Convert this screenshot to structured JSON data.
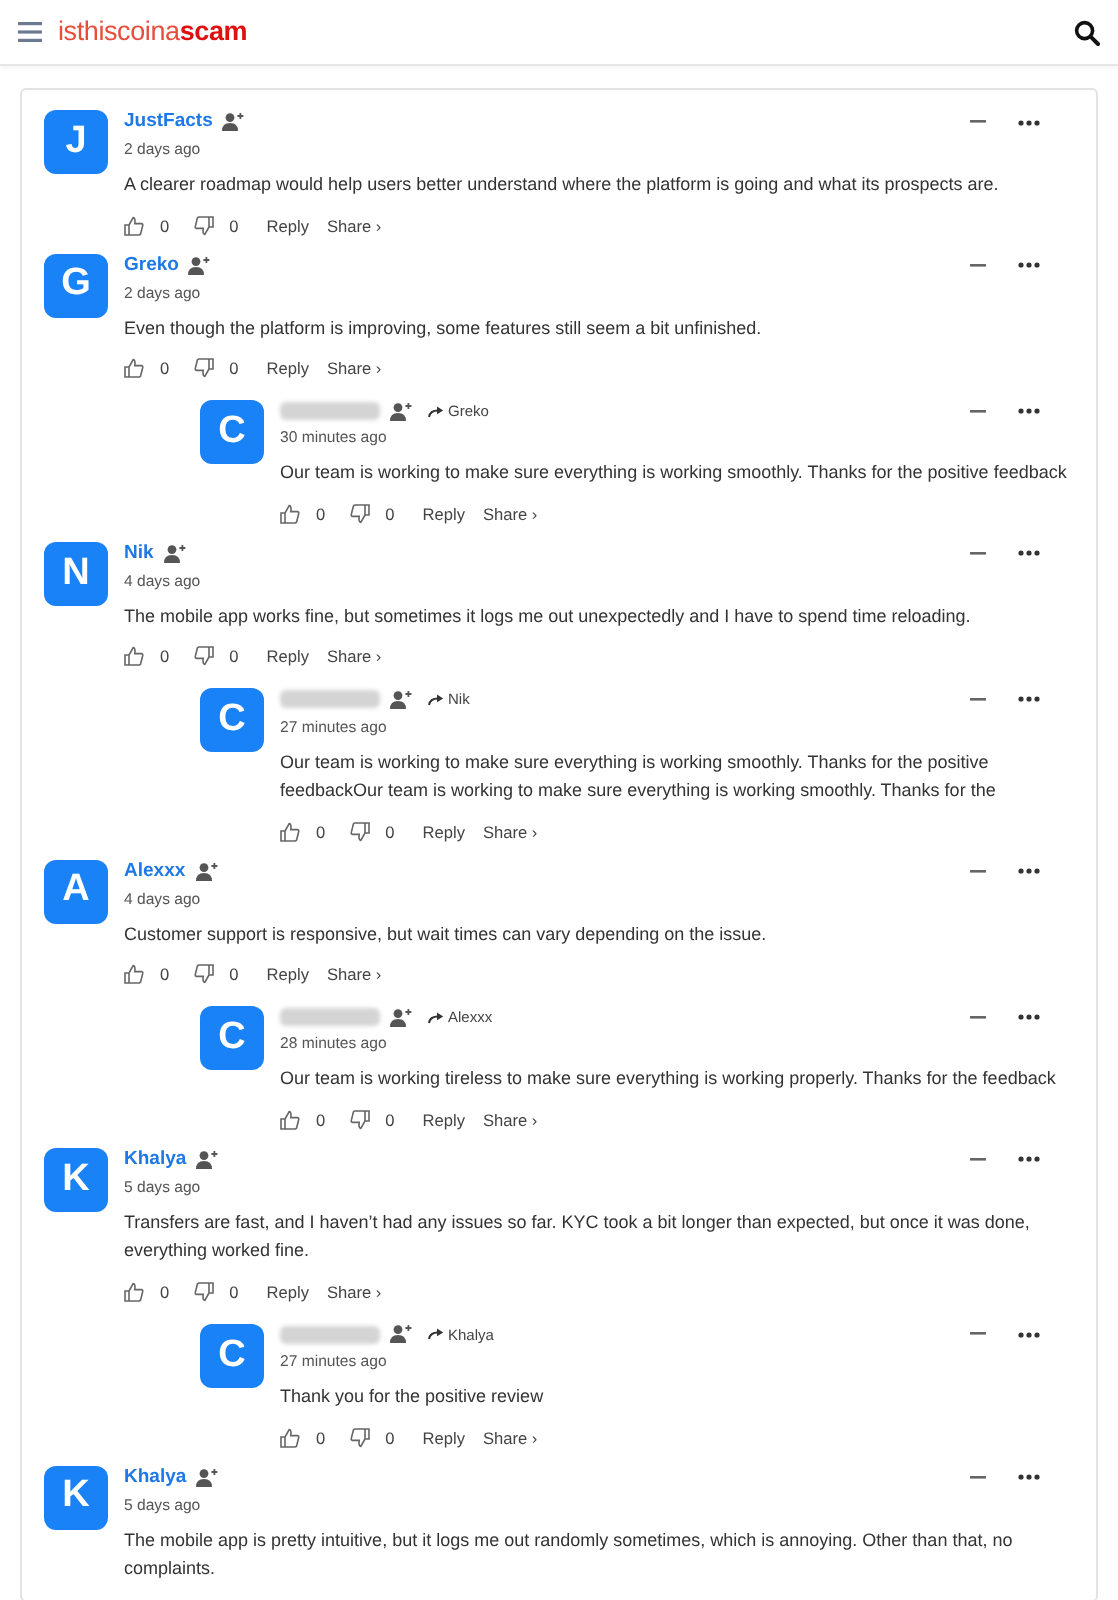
{
  "header": {
    "logo_light": "isthiscoina",
    "logo_bold": "scam"
  },
  "comments": [
    {
      "avatar": "J",
      "name": "JustFacts",
      "time": "2 days ago",
      "text": "A clearer roadmap would help users better understand where the platform is going and what its prospects are.",
      "likes": "0",
      "dislikes": "0",
      "reply_label": "Reply",
      "share_label": "Share ›"
    },
    {
      "avatar": "G",
      "name": "Greko",
      "time": "2 days ago",
      "text": "Even though the platform is improving, some features still seem a bit unfinished.",
      "likes": "0",
      "dislikes": "0",
      "reply_label": "Reply",
      "share_label": "Share ›",
      "replies": [
        {
          "avatar": "C",
          "reply_to": "Greko",
          "time": "30 minutes ago",
          "text": "Our team is working to make sure everything is working smoothly. Thanks for the positive feedback",
          "likes": "0",
          "dislikes": "0",
          "reply_label": "Reply",
          "share_label": "Share ›"
        }
      ]
    },
    {
      "avatar": "N",
      "name": "Nik",
      "time": "4 days ago",
      "text": "The mobile app works fine, but sometimes it logs me out unexpectedly and I have to spend time reloading.",
      "likes": "0",
      "dislikes": "0",
      "reply_label": "Reply",
      "share_label": "Share ›",
      "replies": [
        {
          "avatar": "C",
          "reply_to": "Nik",
          "time": "27 minutes ago",
          "text": "Our team is working to make sure everything is working smoothly. Thanks for the positive feedbackOur team is working to make sure everything is working smoothly. Thanks for the",
          "likes": "0",
          "dislikes": "0",
          "reply_label": "Reply",
          "share_label": "Share ›"
        }
      ]
    },
    {
      "avatar": "A",
      "name": "Alexxx",
      "time": "4 days ago",
      "text": "Customer support is responsive, but wait times can vary depending on the issue.",
      "likes": "0",
      "dislikes": "0",
      "reply_label": "Reply",
      "share_label": "Share ›",
      "replies": [
        {
          "avatar": "C",
          "reply_to": "Alexxx",
          "time": "28 minutes ago",
          "text": "Our team is working tireless to make sure everything is working properly. Thanks for the feedback",
          "likes": "0",
          "dislikes": "0",
          "reply_label": "Reply",
          "share_label": "Share ›"
        }
      ]
    },
    {
      "avatar": "K",
      "name": "Khalya",
      "time": "5 days ago",
      "text": "Transfers are fast, and I haven’t had any issues so far. KYC took a bit longer than expected, but once it was done, everything worked fine.",
      "likes": "0",
      "dislikes": "0",
      "reply_label": "Reply",
      "share_label": "Share ›",
      "replies": [
        {
          "avatar": "C",
          "reply_to": "Khalya",
          "time": "27 minutes ago",
          "text": "Thank you for the positive review",
          "likes": "0",
          "dislikes": "0",
          "reply_label": "Reply",
          "share_label": "Share ›"
        }
      ]
    },
    {
      "avatar": "K",
      "name": "Khalya",
      "time": "5 days ago",
      "text": "The mobile app is pretty intuitive, but it logs me out randomly sometimes, which is annoying. Other than that, no complaints."
    }
  ]
}
